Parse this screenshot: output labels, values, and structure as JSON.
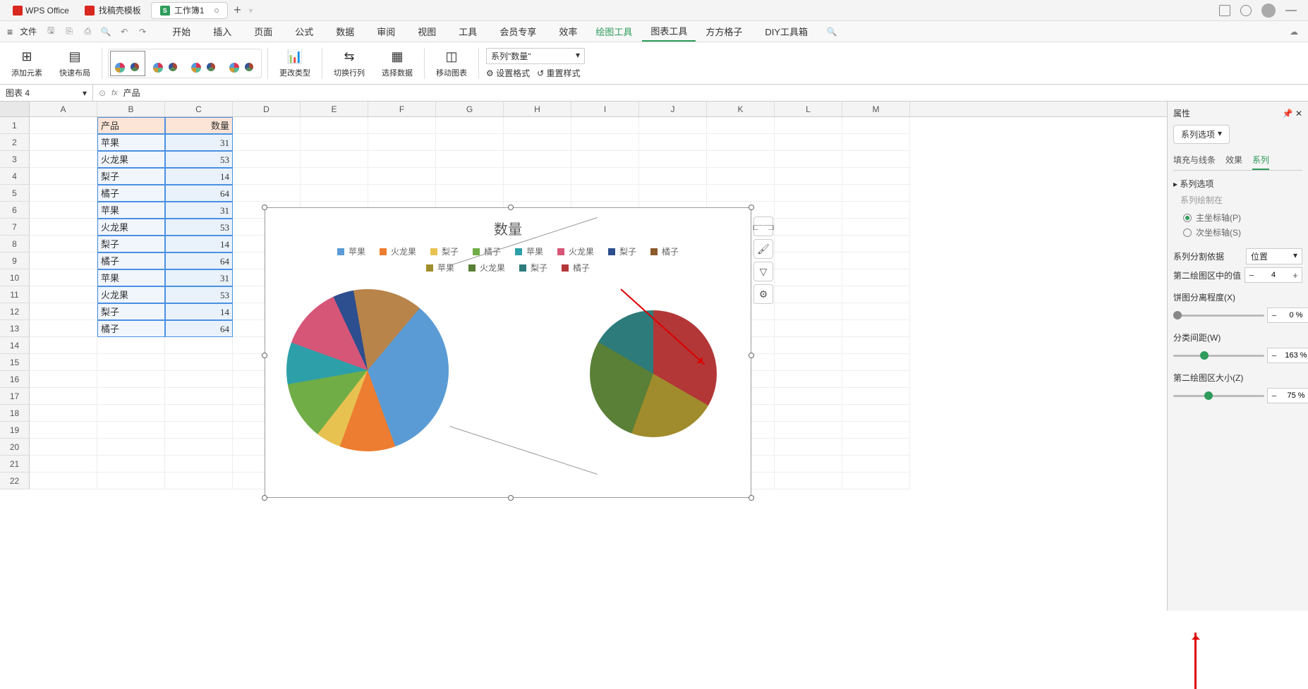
{
  "titlebar": {
    "wps": "WPS Office",
    "tab_template": "找稿壳模板",
    "tab_workbook": "工作簿1"
  },
  "menubar": {
    "file": "文件",
    "items": [
      "开始",
      "插入",
      "页面",
      "公式",
      "数据",
      "审阅",
      "视图",
      "工具",
      "会员专享",
      "效率"
    ],
    "draw_tools": "绘图工具",
    "chart_tools": "图表工具",
    "extras": [
      "方方格子",
      "DIY工具箱"
    ]
  },
  "ribbon": {
    "add_element": "添加元素",
    "quick_layout": "快速布局",
    "change_type": "更改类型",
    "switch_rowcol": "切换行列",
    "select_data": "选择数据",
    "move_chart": "移动图表",
    "series_dd": "系列\"数量\"",
    "set_format": "设置格式",
    "reset_style": "重置样式"
  },
  "formulabar": {
    "name": "图表 4",
    "value": "产品"
  },
  "columns": [
    "A",
    "B",
    "C",
    "D",
    "E",
    "F",
    "G",
    "H",
    "I",
    "J",
    "K",
    "L",
    "M"
  ],
  "rows": 22,
  "table": {
    "header": [
      "产品",
      "数量"
    ],
    "rows": [
      [
        "苹果",
        31
      ],
      [
        "火龙果",
        53
      ],
      [
        "梨子",
        14
      ],
      [
        "橘子",
        64
      ],
      [
        "苹果",
        31
      ],
      [
        "火龙果",
        53
      ],
      [
        "梨子",
        14
      ],
      [
        "橘子",
        64
      ],
      [
        "苹果",
        31
      ],
      [
        "火龙果",
        53
      ],
      [
        "梨子",
        14
      ],
      [
        "橘子",
        64
      ]
    ]
  },
  "chart": {
    "title": "数量",
    "legend": [
      {
        "name": "苹果",
        "color": "#5b9bd5"
      },
      {
        "name": "火龙果",
        "color": "#ed7d31"
      },
      {
        "name": "梨子",
        "color": "#e8c251"
      },
      {
        "name": "橘子",
        "color": "#70ad47"
      },
      {
        "name": "苹果",
        "color": "#2d9fa8"
      },
      {
        "name": "火龙果",
        "color": "#d65678"
      },
      {
        "name": "梨子",
        "color": "#2d4e8f"
      },
      {
        "name": "橘子",
        "color": "#8b5a2b"
      },
      {
        "name": "苹果",
        "color": "#a08c2c"
      },
      {
        "name": "火龙果",
        "color": "#5a7f37"
      },
      {
        "name": "梨子",
        "color": "#2d7b7b"
      },
      {
        "name": "橘子",
        "color": "#b33737"
      }
    ]
  },
  "chart_data": {
    "type": "pie",
    "title": "数量",
    "description": "Pie-of-pie chart: main pie shows first 8 categories, secondary pie shows last 4",
    "categories": [
      "苹果",
      "火龙果",
      "梨子",
      "橘子",
      "苹果",
      "火龙果",
      "梨子",
      "橘子",
      "苹果",
      "火龙果",
      "梨子",
      "橘子"
    ],
    "values": [
      31,
      53,
      14,
      64,
      31,
      53,
      14,
      64,
      31,
      53,
      14,
      64
    ],
    "second_plot_values_count": 4,
    "split_by": "位置",
    "gap_width_pct": 163,
    "second_plot_size_pct": 75,
    "pie_explosion_pct": 0
  },
  "panel": {
    "title": "属性",
    "dd": "系列选项",
    "tabs": [
      "填充与线条",
      "效果",
      "系列"
    ],
    "active_tab": "系列",
    "section_label": "系列选项",
    "drawn_on": "系列绘制在",
    "primary": "主坐标轴(P)",
    "secondary": "次坐标轴(S)",
    "split_label": "系列分割依据",
    "split_val": "位置",
    "second_values_label": "第二绘图区中的值",
    "second_values": "4",
    "explosion_label": "饼图分离程度(X)",
    "explosion": "0 %",
    "gap_label": "分类间距(W)",
    "gap": "163 %",
    "size_label": "第二绘图区大小(Z)",
    "size": "75 %"
  }
}
